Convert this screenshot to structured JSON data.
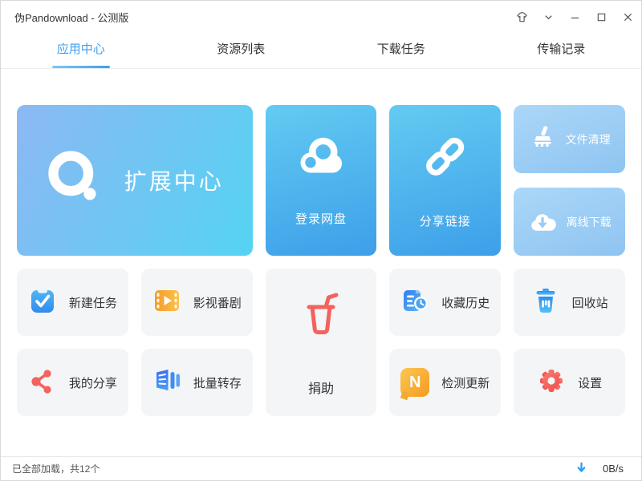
{
  "window": {
    "title": "伪Pandownload - 公测版"
  },
  "titlebar": {
    "icons": [
      "skin-icon",
      "collapse-icon",
      "minimize-icon",
      "maximize-icon",
      "close-icon"
    ]
  },
  "tabs": [
    {
      "label": "应用中心",
      "active": true
    },
    {
      "label": "资源列表",
      "active": false
    },
    {
      "label": "下载任务",
      "active": false
    },
    {
      "label": "传输记录",
      "active": false
    }
  ],
  "tiles": {
    "extension_center": {
      "label": "扩展中心"
    },
    "login_pan": {
      "label": "登录网盘"
    },
    "share_link": {
      "label": "分享链接"
    },
    "file_clean": {
      "label": "文件清理"
    },
    "offline_download": {
      "label": "离线下载"
    },
    "new_task": {
      "label": "新建任务"
    },
    "video": {
      "label": "影视番剧"
    },
    "donate": {
      "label": "捐助"
    },
    "favorites": {
      "label": "收藏历史"
    },
    "recycle_bin": {
      "label": "回收站"
    },
    "my_share": {
      "label": "我的分享"
    },
    "batch_transfer": {
      "label": "批量转存",
      "badge": ""
    },
    "check_update": {
      "label": "检测更新",
      "badge": "N"
    },
    "settings": {
      "label": "设置"
    }
  },
  "statusbar": {
    "status_text": "已全部加载，共12个",
    "download_speed": "0B/s"
  },
  "colors": {
    "accent": "#3f9ff0",
    "big_tile_gradient": [
      "#8cb8f3",
      "#55d3f3"
    ],
    "medium_tile_gradient": [
      "#63cbf2",
      "#3d9fe9"
    ],
    "light_tile_gradient": [
      "#abd7f8",
      "#8fc4f1"
    ],
    "gray_tile": "#f4f5f6",
    "red_icon": "#f4625e",
    "orange_icon": "#f7a928"
  }
}
